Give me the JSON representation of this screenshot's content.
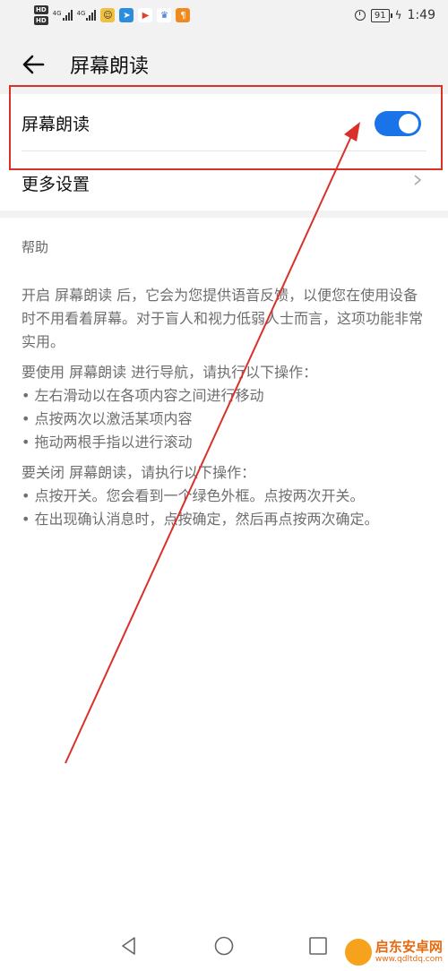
{
  "status_bar": {
    "hd1": "HD",
    "hd2": "HD",
    "net1": "4G",
    "net2": "4G",
    "battery": "91",
    "time": "1:49"
  },
  "header": {
    "title": "屏幕朗读"
  },
  "settings": {
    "screen_reader_label": "屏幕朗读",
    "screen_reader_on": true,
    "more_settings_label": "更多设置"
  },
  "help": {
    "heading": "帮助",
    "para1": "开启 屏幕朗读 后，它会为您提供语音反馈，以便您在使用设备时不用看着屏幕。对于盲人和视力低弱人士而言，这项功能非常实用。",
    "para2_title": "要使用 屏幕朗读 进行导航，请执行以下操作：",
    "para2_items": [
      "• 左右滑动以在各项内容之间进行移动",
      "• 点按两次以激活某项内容",
      "• 拖动两根手指以进行滚动"
    ],
    "para3_title": "要关闭 屏幕朗读，请执行以下操作：",
    "para3_items": [
      "• 点按开关。您会看到一个绿色外框。点按两次开关。",
      "• 在出现确认消息时，点按确定，然后再点按两次确定。"
    ]
  },
  "watermark": {
    "name": "启东安卓网",
    "url": "www.qdltdq.com"
  },
  "colors": {
    "accent": "#1a73e8",
    "annotation": "#d9312a",
    "background": "#f2f2f2"
  }
}
